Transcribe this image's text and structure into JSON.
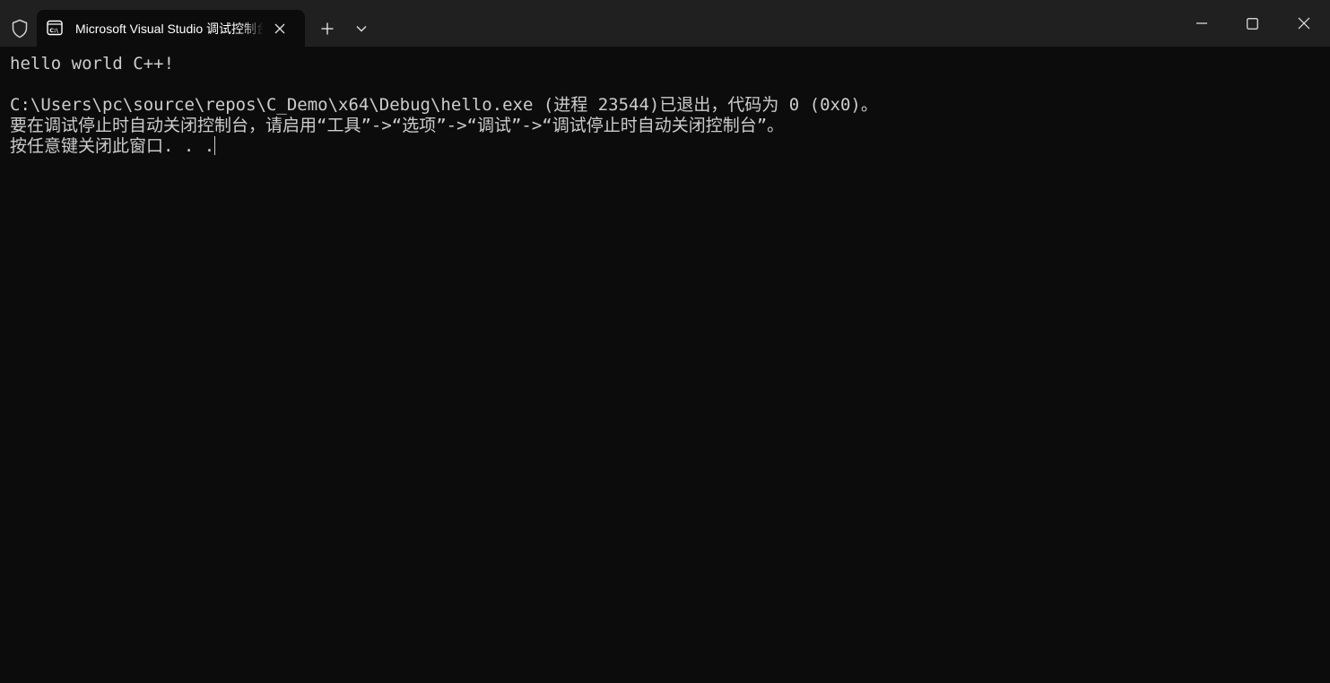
{
  "window": {
    "tab_title": "Microsoft Visual Studio 调试控制台",
    "icons": {
      "shield": "shield-icon",
      "tab": "console-icon",
      "tab_close": "close-icon",
      "new_tab": "plus-icon",
      "tab_dropdown": "chevron-down-icon",
      "minimize": "minimize-icon",
      "maximize": "maximize-icon",
      "close": "close-icon"
    }
  },
  "console": {
    "lines": [
      "hello world C++!",
      "C:\\Users\\pc\\source\\repos\\C_Demo\\x64\\Debug\\hello.exe (进程 23544)已退出，代码为 0 (0x0)。",
      "要在调试停止时自动关闭控制台，请启用“工具”->“选项”->“调试”->“调试停止时自动关闭控制台”。",
      "按任意键关闭此窗口. . ."
    ]
  },
  "colors": {
    "titlebar_bg": "#202020",
    "console_bg": "#0c0c0c",
    "console_text": "#cccccc",
    "tab_text": "#ffffff"
  }
}
